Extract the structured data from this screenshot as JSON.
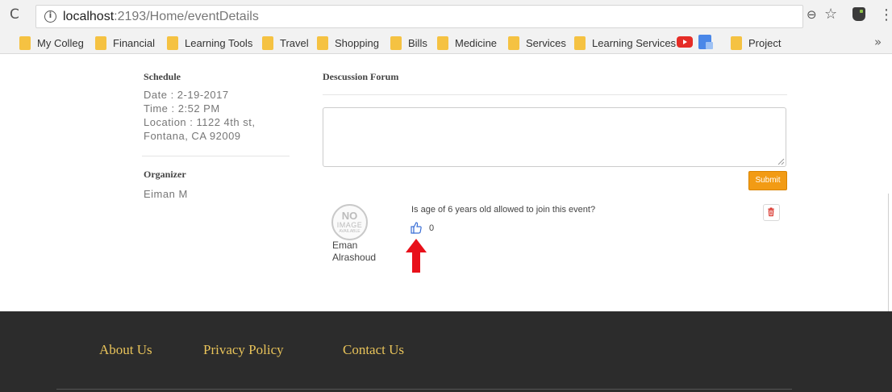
{
  "browser": {
    "url_host": "localhost",
    "url_rest": ":2193/Home/eventDetails",
    "bookmarks": [
      {
        "label": "My Colleg",
        "icon": "folder-icon"
      },
      {
        "label": "Financial",
        "icon": "folder-icon"
      },
      {
        "label": "Learning Tools",
        "icon": "folder-icon"
      },
      {
        "label": "Travel",
        "icon": "folder-icon"
      },
      {
        "label": "Shopping",
        "icon": "folder-icon"
      },
      {
        "label": "Bills",
        "icon": "folder-icon"
      },
      {
        "label": "Medicine",
        "icon": "folder-icon"
      },
      {
        "label": "Services",
        "icon": "folder-icon"
      },
      {
        "label": "Learning Services",
        "icon": "folder-icon"
      },
      {
        "label": "Project",
        "icon": "folder-icon"
      }
    ],
    "more_bookmarks": "»"
  },
  "schedule": {
    "heading": "Schedule",
    "date": "Date : 2-19-2017",
    "time": "Time : 2:52 PM",
    "location_line1": "Location : 1122 4th st,",
    "location_line2": "Fontana, CA 92009"
  },
  "organizer": {
    "heading": "Organizer",
    "name": "Eiman M"
  },
  "forum": {
    "heading": "Descussion Forum",
    "comment_value": "",
    "submit_label": "Submit",
    "posts": [
      {
        "avatar_text_1": "NO",
        "avatar_text_2": "IMAGE",
        "avatar_text_3": "AVAILABLE",
        "author_line1": "Eman",
        "author_line2": "Alrashoud",
        "question": "Is age of 6 years old allowed to join this event?",
        "likes": "0"
      }
    ]
  },
  "footer": {
    "links": [
      "About Us",
      "Privacy Policy",
      "Contact Us"
    ]
  },
  "colors": {
    "accent_orange": "#f29b14",
    "footer_bg": "#2c2c2c",
    "footer_link": "#e8c35a",
    "annotation_arrow": "#e8101a",
    "like_blue": "#3b6fd6"
  }
}
